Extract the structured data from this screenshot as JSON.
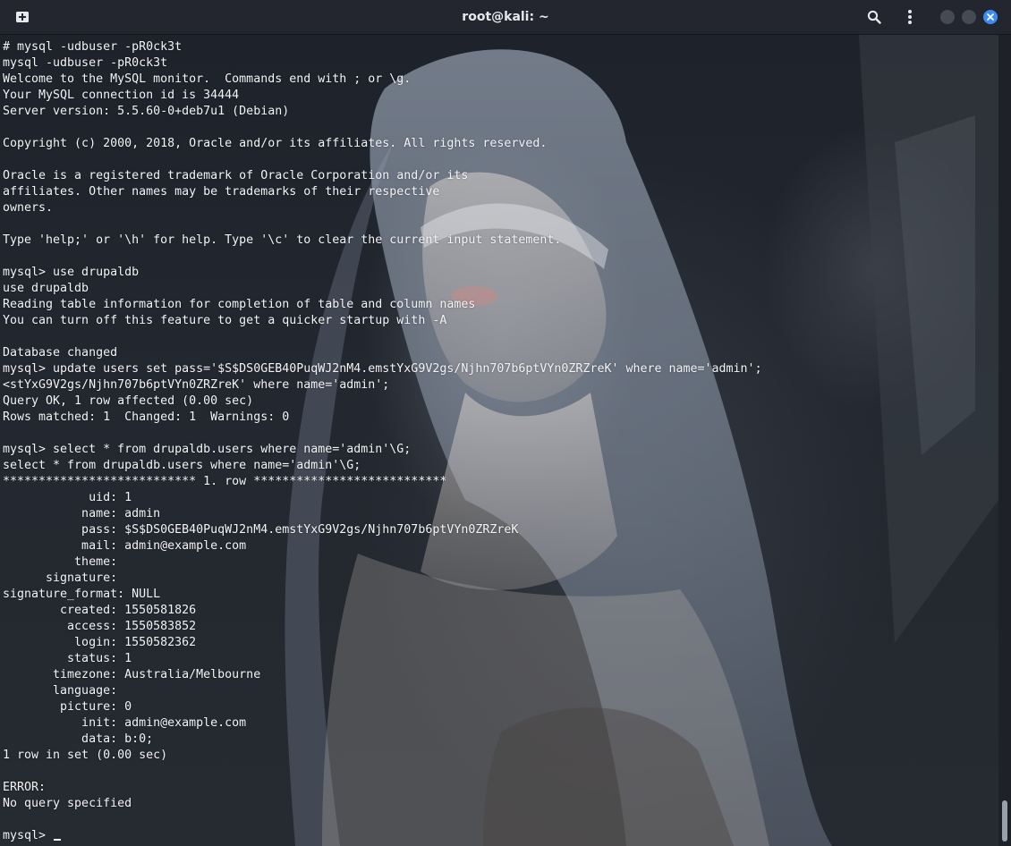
{
  "window": {
    "title": "root@kali: ~"
  },
  "icons": {
    "new_tab": "new-tab-icon",
    "search": "search-icon",
    "menu": "kebab-menu-icon",
    "minimize": "minimize-icon",
    "maximize": "maximize-icon",
    "close": "close-icon"
  },
  "colors": {
    "titlebar": "#23262e",
    "terminal_text": "#f2f3f5",
    "close_button": "#3b8cf5",
    "window_button": "#454a55"
  },
  "terminal": {
    "lines": [
      "# mysql -udbuser -pR0ck3t",
      "mysql -udbuser -pR0ck3t",
      "Welcome to the MySQL monitor.  Commands end with ; or \\g.",
      "Your MySQL connection id is 34444",
      "Server version: 5.5.60-0+deb7u1 (Debian)",
      "",
      "Copyright (c) 2000, 2018, Oracle and/or its affiliates. All rights reserved.",
      "",
      "Oracle is a registered trademark of Oracle Corporation and/or its",
      "affiliates. Other names may be trademarks of their respective",
      "owners.",
      "",
      "Type 'help;' or '\\h' for help. Type '\\c' to clear the current input statement.",
      "",
      "mysql> use drupaldb",
      "use drupaldb",
      "Reading table information for completion of table and column names",
      "You can turn off this feature to get a quicker startup with -A",
      "",
      "Database changed",
      "mysql> update users set pass='$S$DS0GEB40PuqWJ2nM4.emstYxG9V2gs/Njhn707b6ptVYn0ZRZreK' where name='admin';",
      "<stYxG9V2gs/Njhn707b6ptVYn0ZRZreK' where name='admin';",
      "Query OK, 1 row affected (0.00 sec)",
      "Rows matched: 1  Changed: 1  Warnings: 0",
      "",
      "mysql> select * from drupaldb.users where name='admin'\\G;",
      "select * from drupaldb.users where name='admin'\\G;",
      "*************************** 1. row ***************************",
      "            uid: 1",
      "           name: admin",
      "           pass: $S$DS0GEB40PuqWJ2nM4.emstYxG9V2gs/Njhn707b6ptVYn0ZRZreK",
      "           mail: admin@example.com",
      "          theme: ",
      "      signature: ",
      "signature_format: NULL",
      "        created: 1550581826",
      "         access: 1550583852",
      "          login: 1550582362",
      "         status: 1",
      "       timezone: Australia/Melbourne",
      "       language: ",
      "        picture: 0",
      "           init: admin@example.com",
      "           data: b:0;",
      "1 row in set (0.00 sec)",
      "",
      "ERROR: ",
      "No query specified",
      "",
      "mysql> "
    ]
  }
}
